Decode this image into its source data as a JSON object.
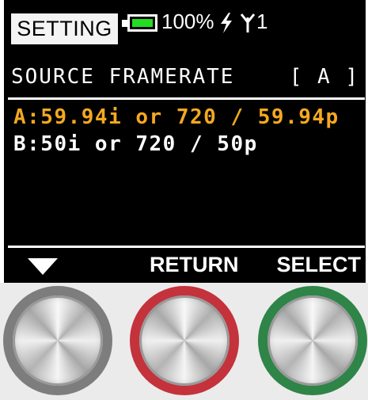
{
  "header": {
    "mode_label": "SETTING",
    "battery": {
      "level": 1.0,
      "text": "100%",
      "fill_color": "#22dd22"
    },
    "power_icon": "lightning-bolt-icon",
    "antenna_icon": "antenna-icon",
    "antenna_number": "1"
  },
  "menu": {
    "title": "SOURCE FRAMERATE",
    "current_value": "[ A ]",
    "options": [
      {
        "label": "A:59.94i or 720 / 59.94p",
        "selected": true,
        "color": "#f4a820"
      },
      {
        "label": "B:50i or 720 / 50p",
        "selected": false,
        "color": "#ffffff"
      }
    ]
  },
  "softkeys": {
    "left_icon": "down-arrow-icon",
    "center_label": "RETURN",
    "right_label": "SELECT"
  },
  "hardware_buttons": [
    {
      "name": "left",
      "ring_color": "#7d7d7d"
    },
    {
      "name": "middle",
      "ring_color": "#c4323b"
    },
    {
      "name": "right",
      "ring_color": "#2f8448"
    }
  ]
}
